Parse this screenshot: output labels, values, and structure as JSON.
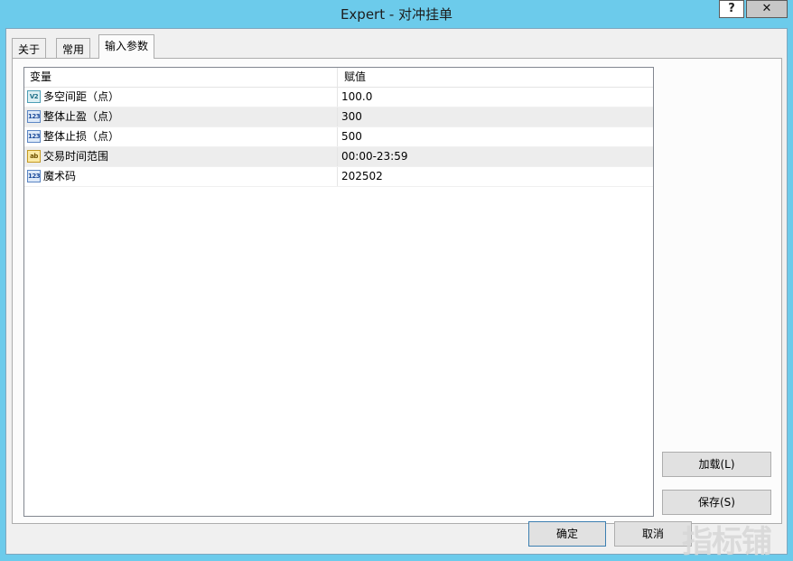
{
  "window": {
    "title": "Expert - 对冲挂单",
    "help_label": "?",
    "close_label": "✕"
  },
  "tabs": [
    {
      "label": "关于"
    },
    {
      "label": "常用"
    },
    {
      "label": "输入参数"
    }
  ],
  "grid": {
    "headers": {
      "variable": "变量",
      "value": "赋值"
    },
    "rows": [
      {
        "icon": "double-type-icon",
        "icon_text": "V2",
        "name": "多空间距（点）",
        "value": "100.0"
      },
      {
        "icon": "int-type-icon",
        "icon_text": "123",
        "name": "整体止盈（点）",
        "value": "300"
      },
      {
        "icon": "int-type-icon",
        "icon_text": "123",
        "name": "整体止损（点）",
        "value": "500"
      },
      {
        "icon": "string-type-icon",
        "icon_text": "ab",
        "name": "交易时间范围",
        "value": "00:00-23:59"
      },
      {
        "icon": "int-type-icon",
        "icon_text": "123",
        "name": "魔术码",
        "value": "202502"
      }
    ]
  },
  "buttons": {
    "load": "加载(L)",
    "save": "保存(S)",
    "ok": "确定",
    "cancel": "取消"
  },
  "watermark": "指标铺"
}
